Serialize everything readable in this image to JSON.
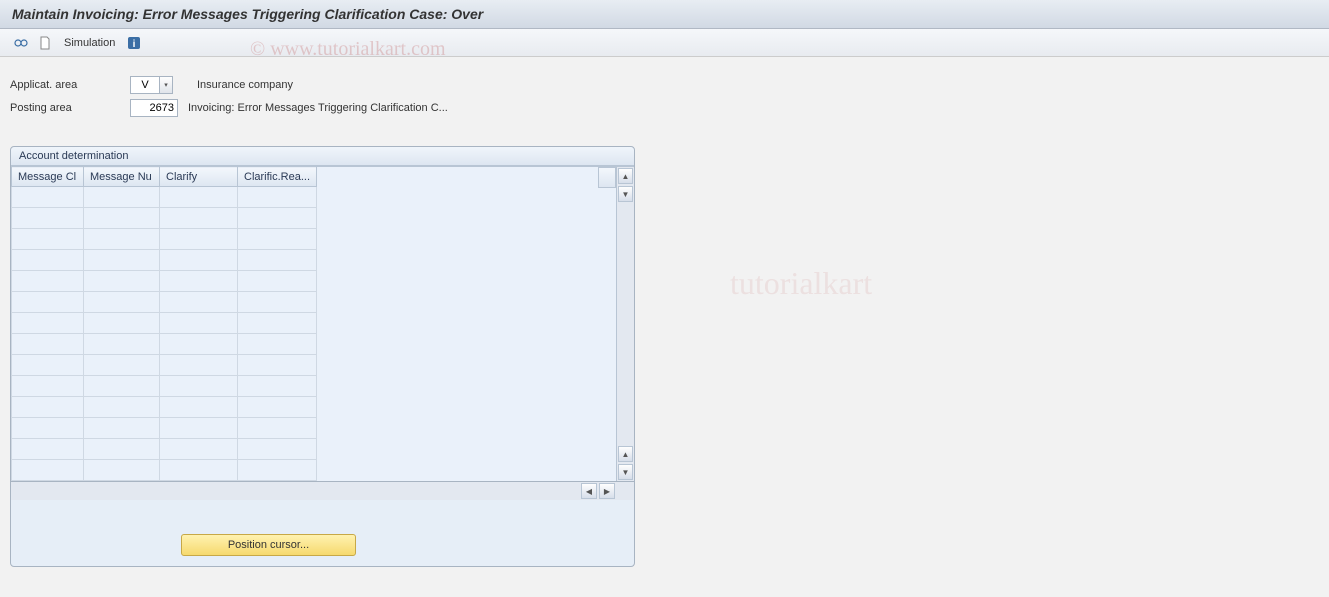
{
  "title": "Maintain Invoicing: Error Messages Triggering Clarification Case: Over",
  "toolbar": {
    "simulation_label": "Simulation"
  },
  "fields": {
    "applicat_area": {
      "label": "Applicat. area",
      "value": "V",
      "desc": "Insurance company"
    },
    "posting_area": {
      "label": "Posting area",
      "value": "2673",
      "desc": "Invoicing: Error Messages Triggering Clarification C..."
    }
  },
  "panel": {
    "title": "Account determination",
    "columns": {
      "message_cl": "Message Cl",
      "message_nu": "Message Nu",
      "clarify": "Clarify",
      "clarific_rea": "Clarific.Rea..."
    },
    "row_count": 14
  },
  "position_button": "Position cursor...",
  "watermark": "© www.tutorialkart.com",
  "watermark2": "tutorialkart"
}
